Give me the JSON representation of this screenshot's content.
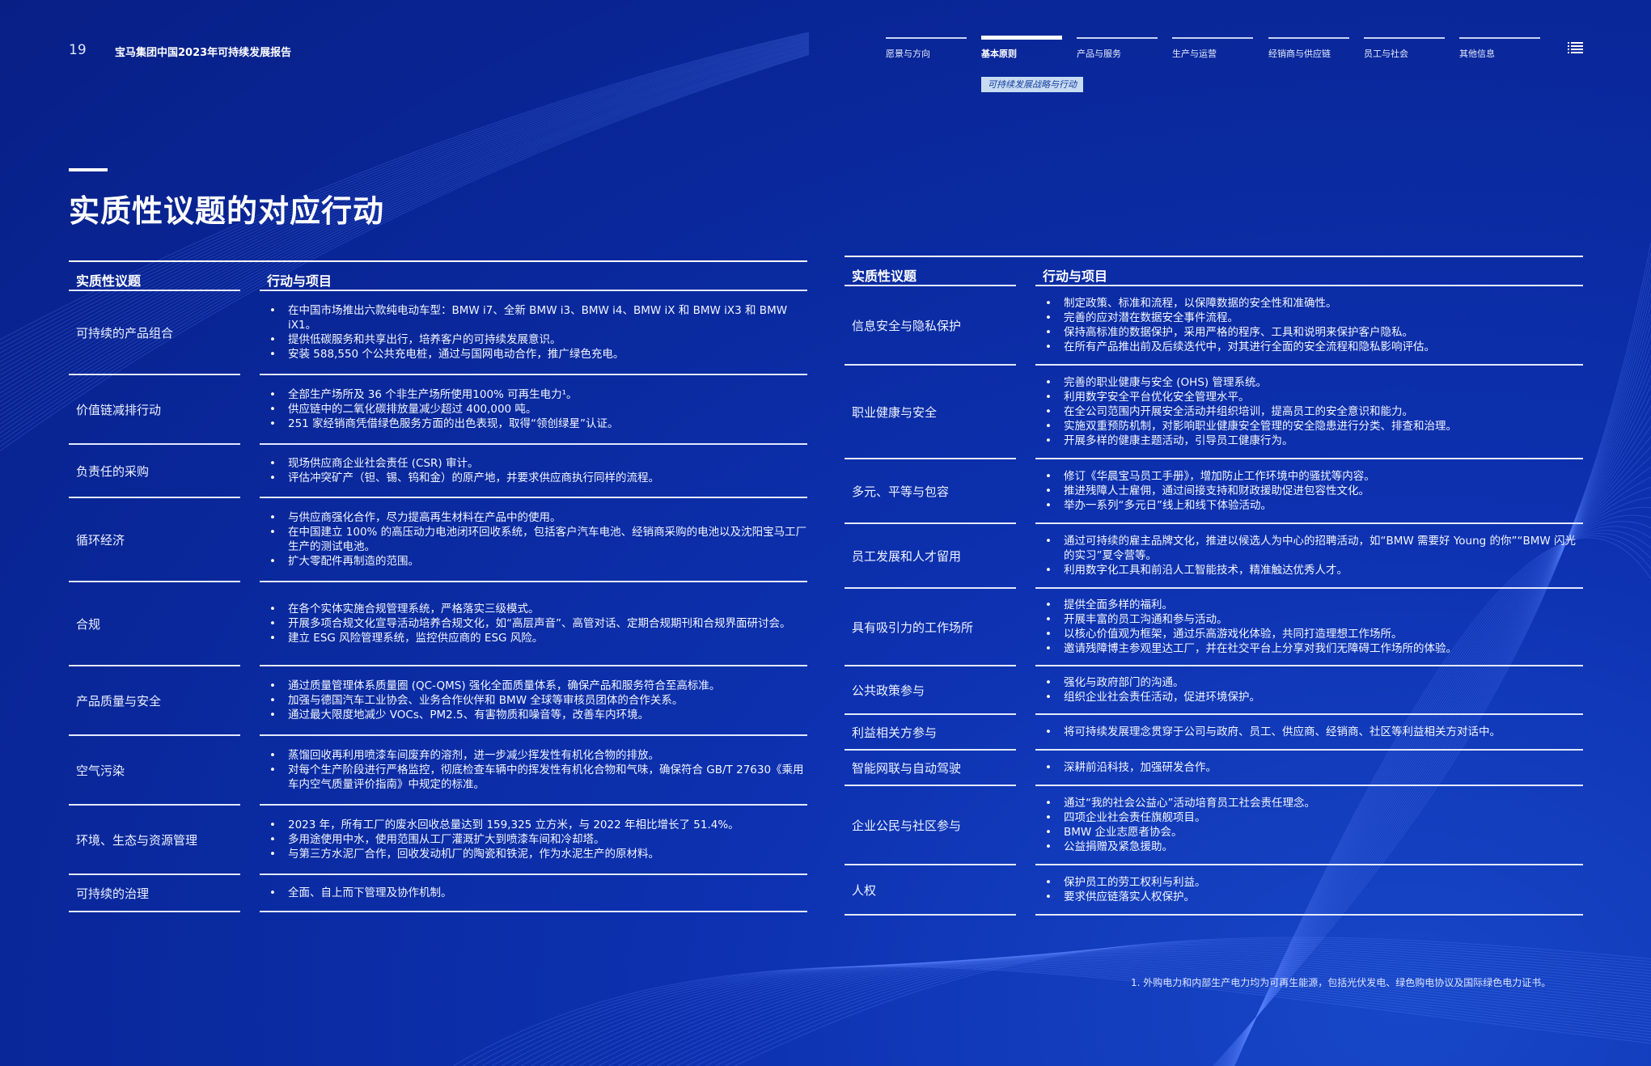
{
  "header": {
    "page_number": "19",
    "report_title": "宝马集团中国2023年可持续发展报告",
    "nav": [
      {
        "label": "愿景与方向",
        "active": false
      },
      {
        "label": "基本原则",
        "active": true
      },
      {
        "label": "产品与服务",
        "active": false
      },
      {
        "label": "生产与运营",
        "active": false
      },
      {
        "label": "经销商与供应链",
        "active": false
      },
      {
        "label": "员工与社会",
        "active": false
      },
      {
        "label": "其他信息",
        "active": false
      }
    ],
    "sub_tag": "可持续发展战略与行动",
    "menu_icon": "list-menu-icon"
  },
  "main_title": "实质性议题的对应行动",
  "left_table": {
    "col_topic": "实质性议题",
    "col_actions": "行动与项目",
    "rows": [
      {
        "topic": "可持续的产品组合",
        "actions": [
          "在中国市场推出六款纯电动车型：BMW i7、全新 BMW i3、BMW i4、BMW iX 和 BMW iX3 和 BMW iX1。",
          "提供低碳服务和共享出行，培养客户的可持续发展意识。",
          "安装 588,550 个公共充电桩，通过与国网电动合作，推广绿色充电。"
        ]
      },
      {
        "topic": "价值链减排行动",
        "actions": [
          "全部生产场所及 36 个非生产场所使用100% 可再生电力¹。",
          "供应链中的二氧化碳排放量减少超过 400,000 吨。",
          "251 家经销商凭借绿色服务方面的出色表现，取得“领创绿星”认证。"
        ]
      },
      {
        "topic": "负责任的采购",
        "actions": [
          "现场供应商企业社会责任 (CSR) 审计。",
          "评估冲突矿产（钽、锡、钨和金）的原产地，并要求供应商执行同样的流程。"
        ]
      },
      {
        "topic": "循环经济",
        "actions": [
          "与供应商强化合作，尽力提高再生材料在产品中的使用。",
          "在中国建立 100% 的高压动力电池闭环回收系统，包括客户汽车电池、经销商采购的电池以及沈阳宝马工厂生产的测试电池。",
          "扩大零配件再制造的范围。"
        ]
      },
      {
        "topic": "合规",
        "actions": [
          "在各个实体实施合规管理系统，严格落实三级模式。",
          "开展多项合规文化宣导活动培养合规文化，如“高层声音”、高管对话、定期合规期刊和合规界面研讨会。",
          "建立 ESG 风险管理系统，监控供应商的 ESG 风险。"
        ]
      },
      {
        "topic": "产品质量与安全",
        "actions": [
          "通过质量管理体系质量圈 (QC-QMS) 强化全面质量体系，确保产品和服务符合至高标准。",
          "加强与德国汽车工业协会、业务合作伙伴和 BMW 全球等审核员团体的合作关系。",
          "通过最大限度地减少 VOCs、PM2.5、有害物质和噪音等，改善车内环境。"
        ]
      },
      {
        "topic": "空气污染",
        "actions": [
          "蒸馏回收再利用喷漆车间废弃的溶剂，进一步减少挥发性有机化合物的排放。",
          "对每个生产阶段进行严格监控，彻底检查车辆中的挥发性有机化合物和气味，确保符合 GB/T 27630《乘用车内空气质量评价指南》中规定的标准。"
        ]
      },
      {
        "topic": "环境、生态与资源管理",
        "actions": [
          "2023 年，所有工厂的废水回收总量达到 159,325 立方米，与 2022 年相比增长了 51.4%。",
          "多用途使用中水，使用范围从工厂灌溉扩大到喷漆车间和冷却塔。",
          "与第三方水泥厂合作，回收发动机厂的陶瓷和铁泥，作为水泥生产的原材料。"
        ]
      },
      {
        "topic": "可持续的治理",
        "actions": [
          "全面、自上而下管理及协作机制。"
        ]
      }
    ]
  },
  "right_table": {
    "col_topic": "实质性议题",
    "col_actions": "行动与项目",
    "rows": [
      {
        "topic": "信息安全与隐私保护",
        "actions": [
          "制定政策、标准和流程，以保障数据的安全性和准确性。",
          "完善的应对潜在数据安全事件流程。",
          "保持高标准的数据保护，采用严格的程序、工具和说明来保护客户隐私。",
          "在所有产品推出前及后续迭代中，对其进行全面的安全流程和隐私影响评估。"
        ]
      },
      {
        "topic": "职业健康与安全",
        "actions": [
          "完善的职业健康与安全 (OHS) 管理系统。",
          "利用数字安全平台优化安全管理水平。",
          "在全公司范围内开展安全活动并组织培训，提高员工的安全意识和能力。",
          "实施双重预防机制，对影响职业健康安全管理的安全隐患进行分类、排查和治理。",
          "开展多样的健康主题活动，引导员工健康行为。"
        ]
      },
      {
        "topic": "多元、平等与包容",
        "actions": [
          "修订《华晨宝马员工手册》，增加防止工作环境中的骚扰等内容。",
          "推进残障人士雇佣，通过间接支持和财政援助促进包容性文化。",
          "举办一系列“多元日”线上和线下体验活动。"
        ]
      },
      {
        "topic": "员工发展和人才留用",
        "actions": [
          "通过可持续的雇主品牌文化，推进以候选人为中心的招聘活动，如“BMW 需要好 Young 的你”“BMW 闪光的实习”夏令营等。",
          "利用数字化工具和前沿人工智能技术，精准触达优秀人才。"
        ]
      },
      {
        "topic": "具有吸引力的工作场所",
        "actions": [
          "提供全面多样的福利。",
          "开展丰富的员工沟通和参与活动。",
          "以核心价值观为框架，通过乐高游戏化体验，共同打造理想工作场所。",
          "邀请残障博主参观里达工厂，并在社交平台上分享对我们无障碍工作场所的体验。"
        ]
      },
      {
        "topic": "公共政策参与",
        "actions": [
          "强化与政府部门的沟通。",
          "组织企业社会责任活动，促进环境保护。"
        ]
      },
      {
        "topic": "利益相关方参与",
        "actions": [
          "将可持续发展理念贯穿于公司与政府、员工、供应商、经销商、社区等利益相关方对话中。"
        ]
      },
      {
        "topic": "智能网联与自动驾驶",
        "actions": [
          "深耕前沿科技，加强研发合作。"
        ]
      },
      {
        "topic": "企业公民与社区参与",
        "actions": [
          "通过“我的社会公益心”活动培育员工社会责任理念。",
          "四项企业社会责任旗舰项目。",
          "BMW 企业志愿者协会。",
          "公益捐赠及紧急援助。"
        ]
      },
      {
        "topic": "人权",
        "actions": [
          "保护员工的劳工权利与利益。",
          "要求供应链落实人权保护。"
        ]
      }
    ]
  },
  "footnote": "1. 外购电力和内部生产电力均为可再生能源，包括光伏发电、绿色购电协议及国际绿色电力证书。"
}
